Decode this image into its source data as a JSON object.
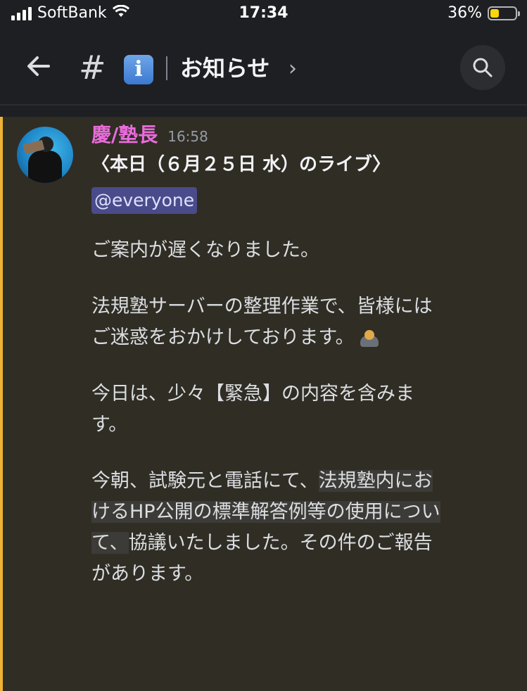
{
  "status": {
    "carrier": "SoftBank",
    "time": "17:34",
    "battery_percent": "36%",
    "battery_level": 0.36,
    "battery_color": "#ffd60a"
  },
  "header": {
    "back_icon": "arrow-left-icon",
    "hash": "#",
    "channel_emoji": "i",
    "channel_name": "お知らせ",
    "chevron": "›",
    "search_icon": "search-icon"
  },
  "message": {
    "author": "慶/塾長",
    "author_color": "#e96cdb",
    "timestamp": "16:58",
    "title": "〈本日（６月２５日 水）のライブ〉",
    "mention": "@everyone",
    "para1": "ご案内が遅くなりました。",
    "para2_line1": "法規塾サーバーの整理作業で、皆様には",
    "para2_line2": "ご迷惑をおかけしております。",
    "para3_line1": "今日は、少々【緊急】の内容を含みま",
    "para3_line2": "す。",
    "para4_a": "今朝、試験元と電話にて、",
    "para4_b": "法規塾内にお",
    "para4_c": "けるHP公開の標準解答例等の使用につい",
    "para4_d": "て、",
    "para4_e": "協議いたしました。その件のご報告",
    "para4_f": "があります。",
    "accent_bar_color": "#f0b232"
  }
}
